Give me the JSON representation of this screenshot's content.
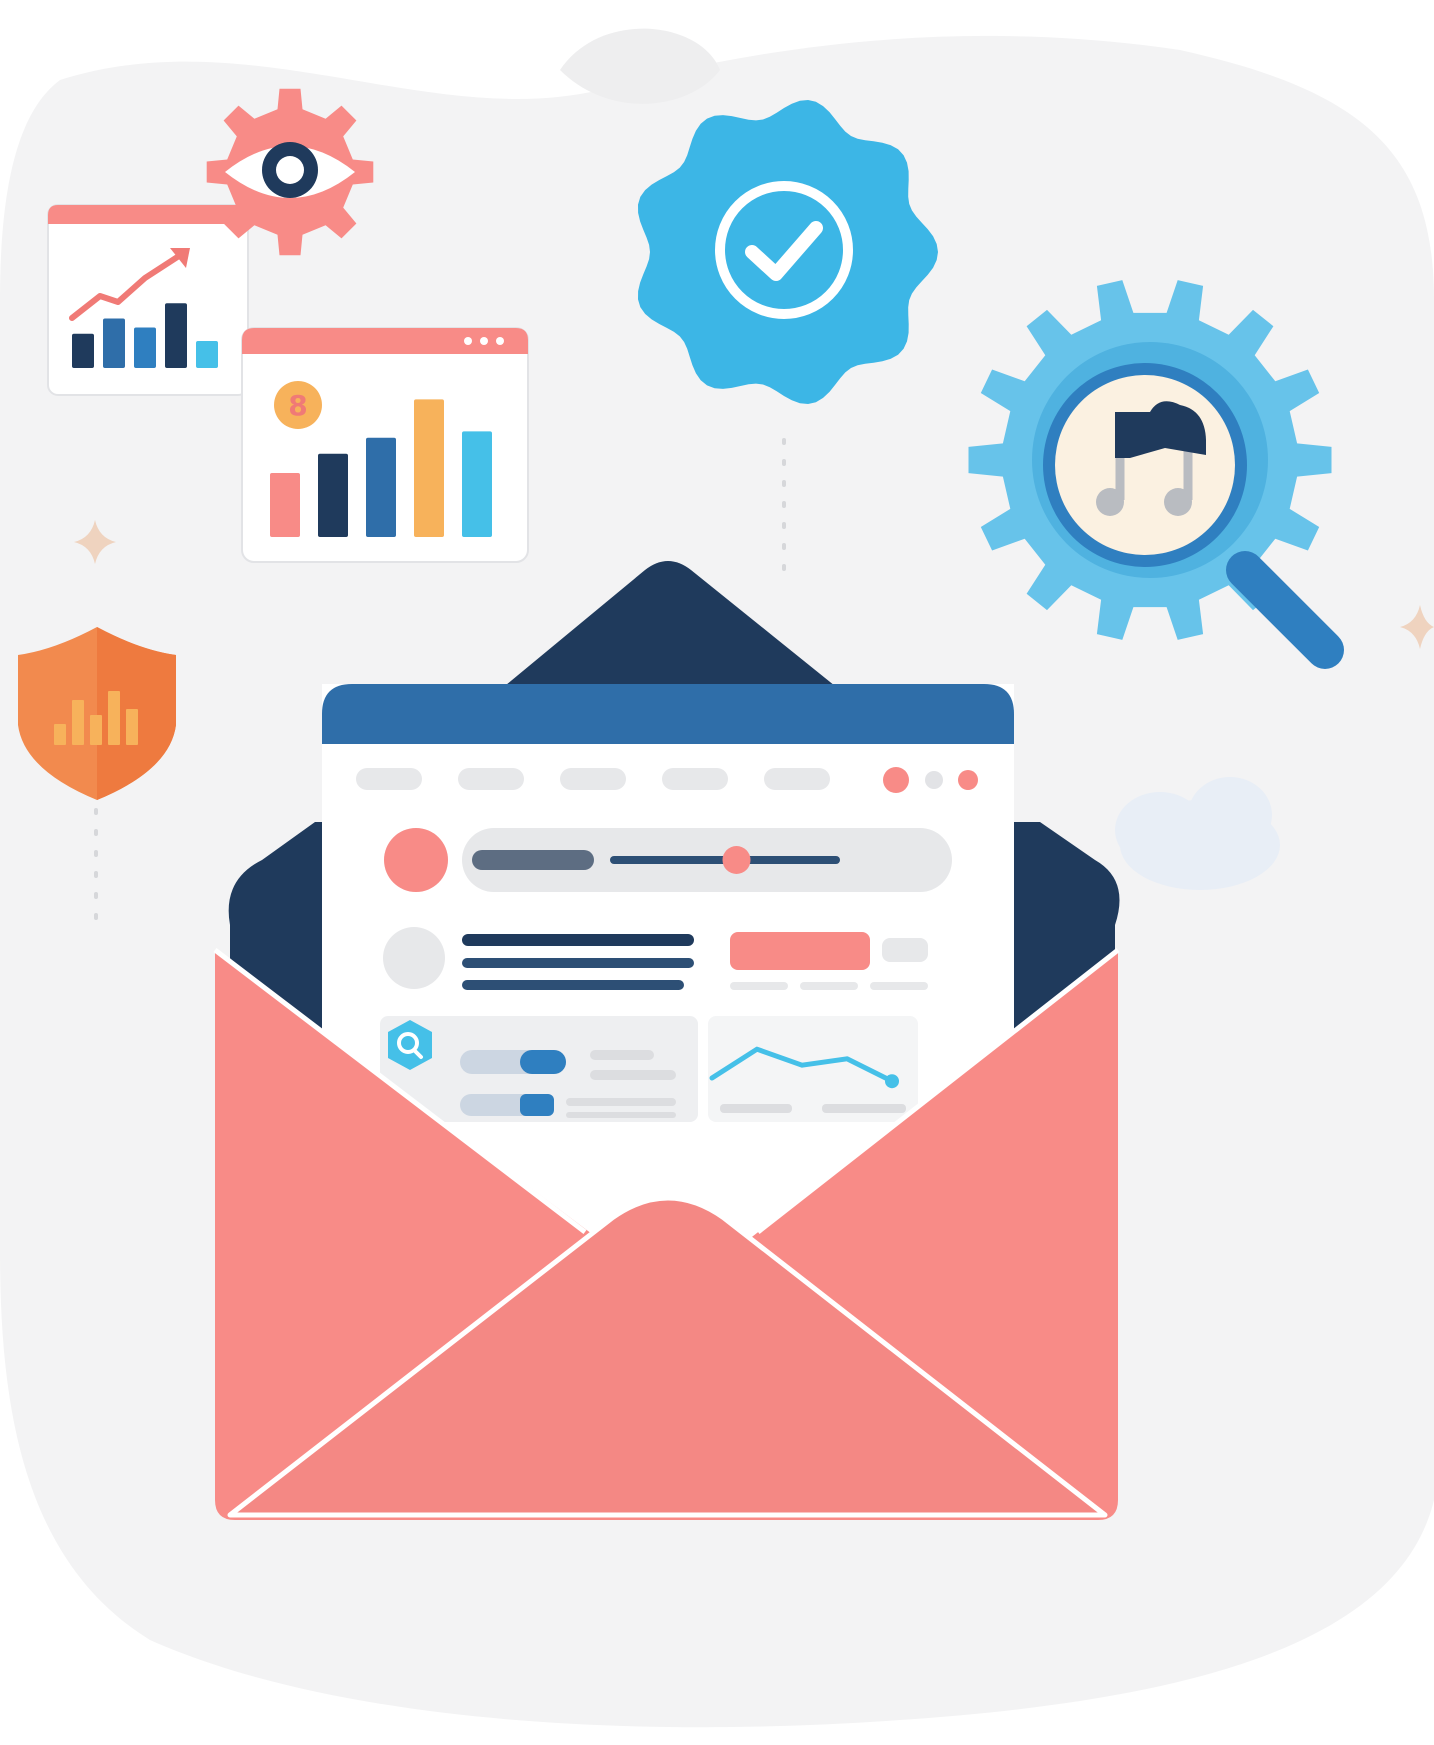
{
  "colors": {
    "background": "#ffffff",
    "blob": "#f3f3f4",
    "coral": "#f88b87",
    "coral_dark": "#f07a76",
    "navy": "#1f3a5c",
    "blue": "#2f7fc0",
    "mid_blue": "#3a8ccf",
    "sky": "#3cb6e6",
    "light_blue": "#67c3ea",
    "orange": "#f28a4e",
    "amber": "#f7b25b",
    "teal": "#45c0e8",
    "cream": "#fbf1e1",
    "grey": "#e7e8ea"
  },
  "icons": {
    "eye_gear": "eye-gear-icon",
    "verified_badge": "checkmark-badge-icon",
    "gear_magnifier": "gear-magnifier-music-cloud-icon",
    "security_shield": "shield-bar-chart-icon",
    "envelope": "open-envelope-icon",
    "search": "search-icon",
    "sparkle": "sparkle-icon",
    "cloud": "cloud-icon"
  },
  "chart_card_small": {
    "bars": [
      0.38,
      0.55,
      0.45,
      0.72,
      0.3
    ],
    "trend": "up"
  },
  "chart_card_large": {
    "badge_text": "8",
    "bars": [
      0.4,
      0.52,
      0.62,
      0.86,
      0.66
    ]
  },
  "shield_chart": {
    "bars": [
      0.35,
      0.75,
      0.5,
      0.9,
      0.6
    ]
  },
  "document": {
    "slider_level": 0.55,
    "line_chart": [
      0.25,
      0.7,
      0.45,
      0.55,
      0.2
    ]
  }
}
